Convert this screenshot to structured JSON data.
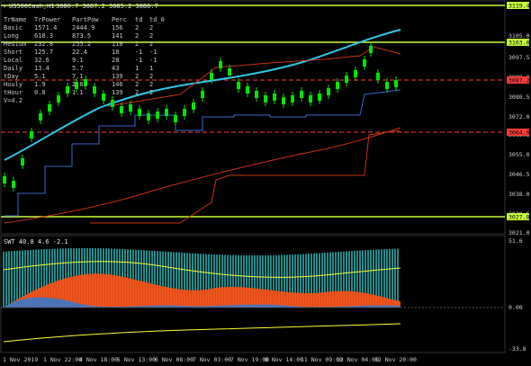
{
  "window": {
    "title": "US500Cash,H1",
    "ohlc": "3086.7 3087.2 3085.2 3086.7",
    "title_icon": "chart-expand-icon"
  },
  "stats_table": {
    "headers": [
      "TrName",
      "TrPower",
      "PartPow",
      "Perc",
      "td",
      "td_0"
    ],
    "rows": [
      [
        "Basic",
        "1571.4",
        "2444.9",
        "156",
        "2",
        "2"
      ],
      [
        "Long",
        "618.3",
        "873.5",
        "141",
        "2",
        "2"
      ],
      [
        "Medium",
        "232.8",
        "255.2",
        "110",
        "2",
        "2"
      ],
      [
        "Short",
        "125.7",
        "22.4",
        "18",
        "-1",
        "-1"
      ],
      [
        "Local",
        "32.6",
        "9.1",
        "28",
        "-1",
        "-1"
      ],
      [
        "Daily",
        "13.4",
        "5.7",
        "43",
        "1",
        "1"
      ],
      [
        "tDay",
        "5.1",
        "7.1",
        "139",
        "2",
        "2"
      ],
      [
        "Houly",
        "1.9",
        "2.8",
        "146",
        "2",
        "2"
      ],
      [
        "tHour",
        "0.8",
        "1.1",
        "139",
        "2",
        "2"
      ]
    ],
    "footer": "V=4.2"
  },
  "price_axis": {
    "ticks": [
      "3105.0",
      "3097.5",
      "3089.0",
      "3080.5",
      "3072.0",
      "3063.5",
      "3055.0",
      "3046.5",
      "3038.0",
      "3029.5",
      "3021.0"
    ],
    "tags": [
      {
        "value": "3119.4",
        "color": "#c8ff3c"
      },
      {
        "value": "3103.0",
        "color": "#c8ff3c"
      },
      {
        "value": "3087.2",
        "color": "#ff3c3c"
      },
      {
        "value": "3064.9",
        "color": "#ff3c3c"
      },
      {
        "value": "3027.8",
        "color": "#c8ff3c"
      }
    ]
  },
  "oscillator": {
    "title": "SWT 40.8 4.6 -2.1",
    "ticks": [
      "51.6",
      "0.00",
      "-33.8"
    ]
  },
  "time_axis": {
    "labels": [
      "1 Nov 2019",
      "1 Nov 22:00",
      "4 Nov 18:00",
      "5 Nov 13:00",
      "6 Nov 08:00",
      "7 Nov 03:00",
      "7 Nov 19:00",
      "8 Nov 14:00",
      "11 Nov 09:00",
      "12 Nov 04:00",
      "12 Nov 20:00"
    ]
  },
  "colors": {
    "background": "#000000",
    "candle": "#00e600",
    "ma_cyan": "#2ec8e6",
    "level_lime": "#c8ff3c",
    "level_red": "#ff3c3c",
    "band_red": "#c83214",
    "band_blue": "#3c64c8",
    "osc_teal": "#1e8c8c",
    "osc_orange": "#ff5014",
    "osc_blue": "#3c78c8",
    "osc_yellow": "#ffff32"
  }
}
